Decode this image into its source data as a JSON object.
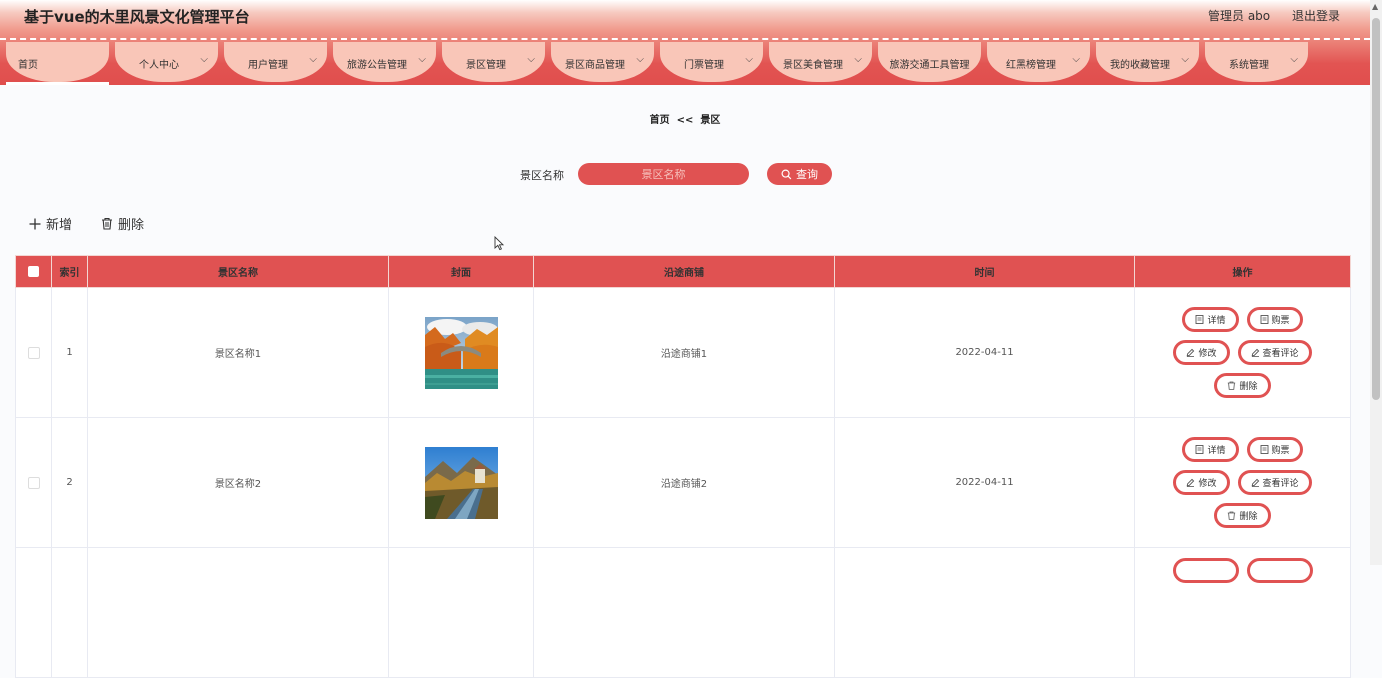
{
  "app": {
    "title": "基于vue的木里风景文化管理平台"
  },
  "user": {
    "role_label": "管理员 abo",
    "logout": "退出登录"
  },
  "nav": {
    "items": [
      {
        "label": "首页",
        "chevron": false,
        "active": true
      },
      {
        "label": "个人中心",
        "chevron": true
      },
      {
        "label": "用户管理",
        "chevron": true
      },
      {
        "label": "旅游公告管理",
        "chevron": true
      },
      {
        "label": "景区管理",
        "chevron": true
      },
      {
        "label": "景区商品管理",
        "chevron": true
      },
      {
        "label": "门票管理",
        "chevron": true
      },
      {
        "label": "景区美食管理",
        "chevron": true
      },
      {
        "label": "旅游交通工具管理",
        "chevron": false
      },
      {
        "label": "红黑榜管理",
        "chevron": true
      },
      {
        "label": "我的收藏管理",
        "chevron": true
      },
      {
        "label": "系统管理",
        "chevron": true
      }
    ]
  },
  "breadcrumb": {
    "home": "首页",
    "separator": "<<",
    "current": "景区"
  },
  "search": {
    "label": "景区名称",
    "placeholder": "景区名称",
    "button": "查询"
  },
  "toolbar": {
    "add": "新增",
    "delete": "删除"
  },
  "table": {
    "columns": [
      "索引",
      "景区名称",
      "封面",
      "沿途商铺",
      "时间",
      "操作"
    ],
    "rows": [
      {
        "index": "1",
        "name": "景区名称1",
        "shop": "沿途商铺1",
        "time": "2022-04-11"
      },
      {
        "index": "2",
        "name": "景区名称2",
        "shop": "沿途商铺2",
        "time": "2022-04-11"
      }
    ],
    "actions": {
      "detail": "详情",
      "buy": "购票",
      "edit": "修改",
      "comments": "查看评论",
      "delete": "删除"
    }
  },
  "colors": {
    "accent": "#e05252",
    "nav_tab": "#f9c6b8"
  }
}
